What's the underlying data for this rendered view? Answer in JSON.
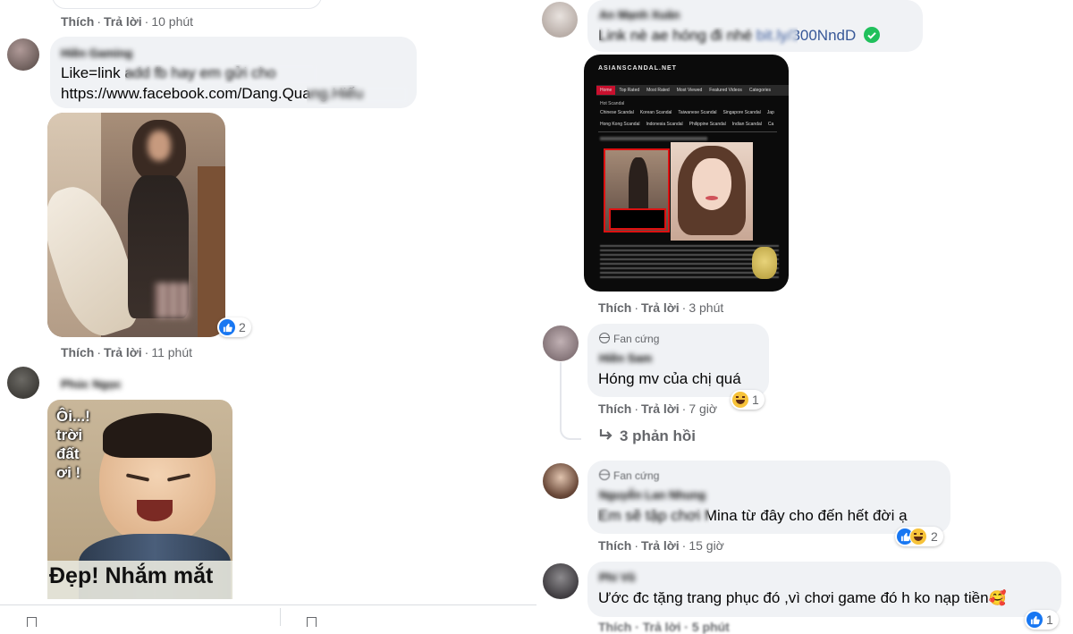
{
  "left": {
    "top_actions": {
      "like": "Thích",
      "reply": "Trả lời",
      "time": "10 phút"
    },
    "c1": {
      "name": "Hiền Gaming",
      "line1": "Like=link add fb hay em gửi cho",
      "line2": "https://www.facebook.com/Dang.Quang.Hiếu",
      "reaction_count": "2",
      "actions": {
        "like": "Thích",
        "reply": "Trả lời",
        "time": "11 phút"
      }
    },
    "c2": {
      "name": "Phúc Ngọc",
      "meme": {
        "top": "Ôi...!\ntrời\nđất\nơi !",
        "bottom": "Đẹp! Nhắm mắt"
      }
    }
  },
  "right": {
    "c1": {
      "name": "An Mạnh Xuân",
      "text_prefix": "Link nè ae hóng đi nhé ",
      "link": "bit.ly/300NndD",
      "actions": {
        "like": "Thích",
        "reply": "Trả lời",
        "time": "3 phút"
      },
      "site": {
        "logo": "ASIANSCANDAL.NET",
        "nav": [
          "Home",
          "Top Rated",
          "Most Rated",
          "Most Viewed",
          "Featured Videos",
          "Categories"
        ],
        "section": "Hot Scandal",
        "cats_row1": [
          "Chinese Scandal",
          "Korean Scandal",
          "Taiwanese Scandal",
          "Singapore Scandal",
          "Jap"
        ],
        "cats_row2": [
          "Hong Kong Scandal",
          "Indonesia Scandal",
          "Philippine Scandal",
          "Indian Scandal",
          "Ca"
        ]
      }
    },
    "c2": {
      "badge": "Fan cứng",
      "name": "Hiền Sam",
      "text": "Hóng mv của chị quá",
      "reaction_count": "1",
      "actions": {
        "like": "Thích",
        "reply": "Trả lời",
        "time": "7 giờ"
      },
      "replies": "3 phản hồi"
    },
    "c3": {
      "badge": "Fan cứng",
      "name": "Nguyễn Lan Nhung",
      "text": "Em sẽ tập chơi Mina từ đây cho đến hết đời ạ",
      "reaction_count": "2",
      "actions": {
        "like": "Thích",
        "reply": "Trả lời",
        "time": "15 giờ"
      }
    },
    "c4": {
      "name": "Phi Vũ",
      "text": "Ước đc tặng trang phục đó ,vì chơi game đó h ko nạp tiền",
      "emoji": "🥰",
      "reaction_count": "1",
      "actions_partial": "Thích · Trả lời · 5 phút"
    }
  },
  "colors": {
    "link": "#385898",
    "bubble": "#f0f2f5",
    "meta": "#65676b",
    "like_blue": "#1877f2",
    "verified": "#20c05c"
  }
}
